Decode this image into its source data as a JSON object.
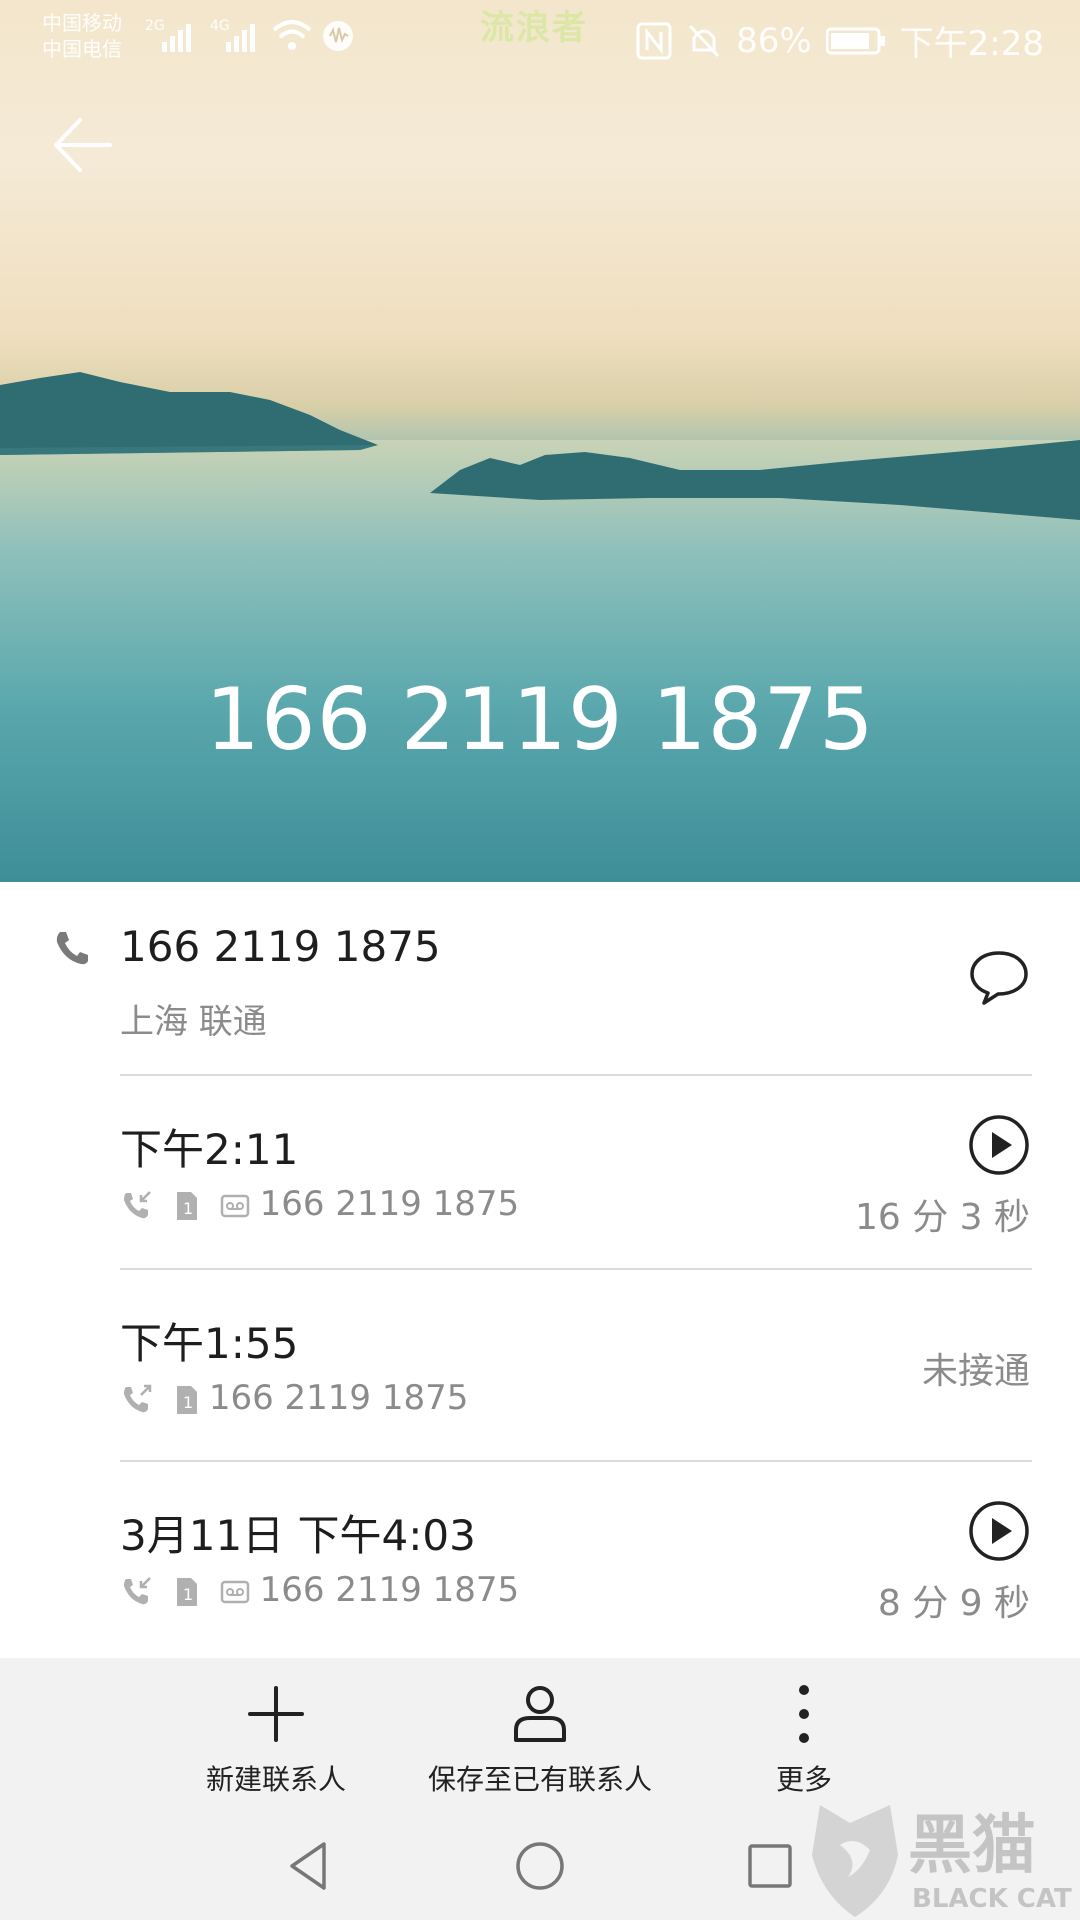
{
  "status_bar": {
    "carrier1": "中国移动",
    "carrier2": "中国电信",
    "sig1": "2G",
    "sig2": "4G",
    "battery": "86%",
    "time": "下午2:28",
    "watermark": "流浪者"
  },
  "header": {
    "number": "166 2119 1875"
  },
  "contact": {
    "number": "166 2119 1875",
    "location": "上海 联通"
  },
  "calls": [
    {
      "time": "下午2:11",
      "number": "166 2119 1875",
      "status": "16 分 3 秒"
    },
    {
      "time": "下午1:55",
      "number": "166 2119 1875",
      "status": "未接通"
    },
    {
      "time": "3月11日 下午4:03",
      "number": "166 2119 1875",
      "status": "8 分 9 秒"
    }
  ],
  "actions": {
    "new_contact": "新建联系人",
    "save_existing": "保存至已有联系人",
    "more": "更多"
  },
  "logo": {
    "cn": "黑猫",
    "en": "BLACK CAT"
  },
  "colors": {
    "sky": "#f3e6cc",
    "sea": "#4f9fa5",
    "island": "#2f6d72",
    "bar_bg": "#f2f2f2"
  }
}
